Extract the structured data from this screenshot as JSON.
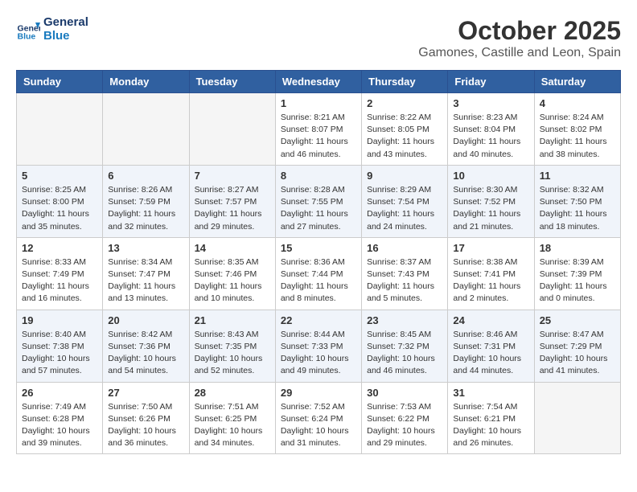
{
  "logo": {
    "line1": "General",
    "line2": "Blue"
  },
  "title": "October 2025",
  "location": "Gamones, Castille and Leon, Spain",
  "weekdays": [
    "Sunday",
    "Monday",
    "Tuesday",
    "Wednesday",
    "Thursday",
    "Friday",
    "Saturday"
  ],
  "weeks": [
    [
      {
        "day": "",
        "info": ""
      },
      {
        "day": "",
        "info": ""
      },
      {
        "day": "",
        "info": ""
      },
      {
        "day": "1",
        "info": "Sunrise: 8:21 AM\nSunset: 8:07 PM\nDaylight: 11 hours and 46 minutes."
      },
      {
        "day": "2",
        "info": "Sunrise: 8:22 AM\nSunset: 8:05 PM\nDaylight: 11 hours and 43 minutes."
      },
      {
        "day": "3",
        "info": "Sunrise: 8:23 AM\nSunset: 8:04 PM\nDaylight: 11 hours and 40 minutes."
      },
      {
        "day": "4",
        "info": "Sunrise: 8:24 AM\nSunset: 8:02 PM\nDaylight: 11 hours and 38 minutes."
      }
    ],
    [
      {
        "day": "5",
        "info": "Sunrise: 8:25 AM\nSunset: 8:00 PM\nDaylight: 11 hours and 35 minutes."
      },
      {
        "day": "6",
        "info": "Sunrise: 8:26 AM\nSunset: 7:59 PM\nDaylight: 11 hours and 32 minutes."
      },
      {
        "day": "7",
        "info": "Sunrise: 8:27 AM\nSunset: 7:57 PM\nDaylight: 11 hours and 29 minutes."
      },
      {
        "day": "8",
        "info": "Sunrise: 8:28 AM\nSunset: 7:55 PM\nDaylight: 11 hours and 27 minutes."
      },
      {
        "day": "9",
        "info": "Sunrise: 8:29 AM\nSunset: 7:54 PM\nDaylight: 11 hours and 24 minutes."
      },
      {
        "day": "10",
        "info": "Sunrise: 8:30 AM\nSunset: 7:52 PM\nDaylight: 11 hours and 21 minutes."
      },
      {
        "day": "11",
        "info": "Sunrise: 8:32 AM\nSunset: 7:50 PM\nDaylight: 11 hours and 18 minutes."
      }
    ],
    [
      {
        "day": "12",
        "info": "Sunrise: 8:33 AM\nSunset: 7:49 PM\nDaylight: 11 hours and 16 minutes."
      },
      {
        "day": "13",
        "info": "Sunrise: 8:34 AM\nSunset: 7:47 PM\nDaylight: 11 hours and 13 minutes."
      },
      {
        "day": "14",
        "info": "Sunrise: 8:35 AM\nSunset: 7:46 PM\nDaylight: 11 hours and 10 minutes."
      },
      {
        "day": "15",
        "info": "Sunrise: 8:36 AM\nSunset: 7:44 PM\nDaylight: 11 hours and 8 minutes."
      },
      {
        "day": "16",
        "info": "Sunrise: 8:37 AM\nSunset: 7:43 PM\nDaylight: 11 hours and 5 minutes."
      },
      {
        "day": "17",
        "info": "Sunrise: 8:38 AM\nSunset: 7:41 PM\nDaylight: 11 hours and 2 minutes."
      },
      {
        "day": "18",
        "info": "Sunrise: 8:39 AM\nSunset: 7:39 PM\nDaylight: 11 hours and 0 minutes."
      }
    ],
    [
      {
        "day": "19",
        "info": "Sunrise: 8:40 AM\nSunset: 7:38 PM\nDaylight: 10 hours and 57 minutes."
      },
      {
        "day": "20",
        "info": "Sunrise: 8:42 AM\nSunset: 7:36 PM\nDaylight: 10 hours and 54 minutes."
      },
      {
        "day": "21",
        "info": "Sunrise: 8:43 AM\nSunset: 7:35 PM\nDaylight: 10 hours and 52 minutes."
      },
      {
        "day": "22",
        "info": "Sunrise: 8:44 AM\nSunset: 7:33 PM\nDaylight: 10 hours and 49 minutes."
      },
      {
        "day": "23",
        "info": "Sunrise: 8:45 AM\nSunset: 7:32 PM\nDaylight: 10 hours and 46 minutes."
      },
      {
        "day": "24",
        "info": "Sunrise: 8:46 AM\nSunset: 7:31 PM\nDaylight: 10 hours and 44 minutes."
      },
      {
        "day": "25",
        "info": "Sunrise: 8:47 AM\nSunset: 7:29 PM\nDaylight: 10 hours and 41 minutes."
      }
    ],
    [
      {
        "day": "26",
        "info": "Sunrise: 7:49 AM\nSunset: 6:28 PM\nDaylight: 10 hours and 39 minutes."
      },
      {
        "day": "27",
        "info": "Sunrise: 7:50 AM\nSunset: 6:26 PM\nDaylight: 10 hours and 36 minutes."
      },
      {
        "day": "28",
        "info": "Sunrise: 7:51 AM\nSunset: 6:25 PM\nDaylight: 10 hours and 34 minutes."
      },
      {
        "day": "29",
        "info": "Sunrise: 7:52 AM\nSunset: 6:24 PM\nDaylight: 10 hours and 31 minutes."
      },
      {
        "day": "30",
        "info": "Sunrise: 7:53 AM\nSunset: 6:22 PM\nDaylight: 10 hours and 29 minutes."
      },
      {
        "day": "31",
        "info": "Sunrise: 7:54 AM\nSunset: 6:21 PM\nDaylight: 10 hours and 26 minutes."
      },
      {
        "day": "",
        "info": ""
      }
    ]
  ]
}
